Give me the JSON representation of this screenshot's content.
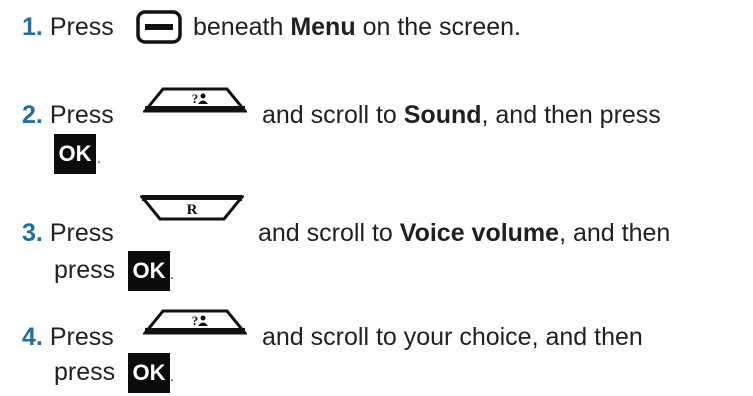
{
  "steps": [
    {
      "number": "1.",
      "press": "Press",
      "text_after_icon": "beneath",
      "bold_word": "Menu",
      "tail": "on the screen.",
      "icon": "softkey-minus-icon"
    },
    {
      "number": "2.",
      "press": "Press",
      "mid": "and scroll to",
      "bold_word": "Sound",
      "tail": ", and then press",
      "end": ".",
      "icon": "nav-up-key-icon",
      "ok_label": "OK"
    },
    {
      "number": "3.",
      "press": "Press",
      "mid": "and scroll to",
      "bold_word": "Voice volume",
      "tail": ", and then",
      "press2": "press",
      "end": ".",
      "icon": "nav-down-r-key-icon",
      "key_label": "R",
      "ok_label": "OK"
    },
    {
      "number": "4.",
      "press": "Press",
      "mid": "and scroll to your choice, and then",
      "press2": "press",
      "end": ".",
      "icon": "nav-up-key-icon",
      "ok_label": "OK"
    }
  ],
  "colors": {
    "step_number": "#1d6fa5",
    "text": "#231f20",
    "ok_key": "#0c0c0c"
  }
}
